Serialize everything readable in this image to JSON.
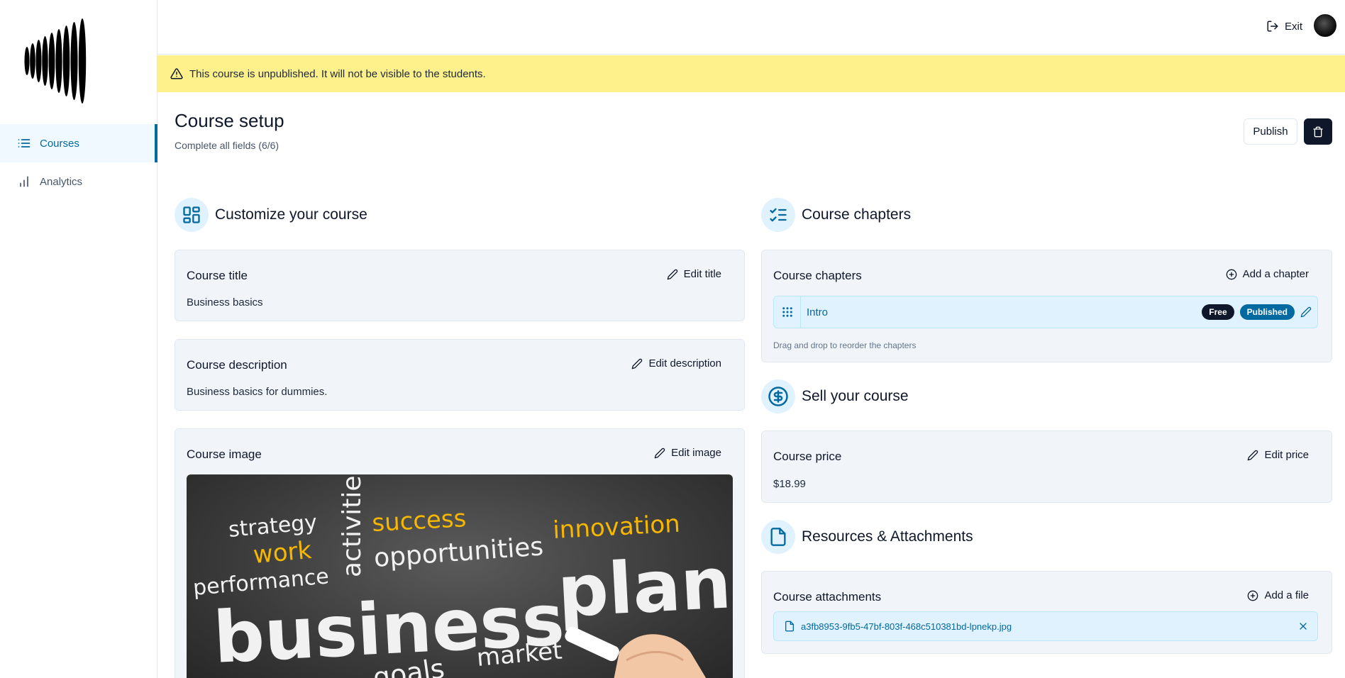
{
  "sidebar": {
    "items": [
      {
        "label": "Courses",
        "icon": "list-icon",
        "active": true
      },
      {
        "label": "Analytics",
        "icon": "bar-chart-icon",
        "active": false
      }
    ]
  },
  "topbar": {
    "exit_label": "Exit"
  },
  "banner": {
    "text": "This course is unpublished. It will not be visible to the students."
  },
  "header": {
    "title": "Course setup",
    "subtitle": "Complete all fields (6/6)",
    "publish_label": "Publish"
  },
  "customize": {
    "heading": "Customize your course",
    "title_card": {
      "label": "Course title",
      "action": "Edit title",
      "value": "Business basics"
    },
    "description_card": {
      "label": "Course description",
      "action": "Edit description",
      "value": "Business basics for dummies."
    },
    "image_card": {
      "label": "Course image",
      "action": "Edit image",
      "image_words": [
        "strategy",
        "work",
        "performance",
        "activities",
        "success",
        "opportunities",
        "innovation",
        "business",
        "plan",
        "goals",
        "market"
      ]
    }
  },
  "chapters": {
    "heading": "Course chapters",
    "card_label": "Course chapters",
    "add_label": "Add a chapter",
    "items": [
      {
        "title": "Intro",
        "badges": [
          "Free",
          "Published"
        ]
      }
    ],
    "hint": "Drag and drop to reorder the chapters"
  },
  "sell": {
    "heading": "Sell your course",
    "price_card": {
      "label": "Course price",
      "action": "Edit price",
      "value": "$18.99"
    }
  },
  "resources": {
    "heading": "Resources & Attachments",
    "card_label": "Course attachments",
    "add_label": "Add a file",
    "files": [
      "a3fb8953-9fb5-47bf-803f-468c510381bd-lpnekp.jpg"
    ]
  },
  "colors": {
    "accent": "#0369a1",
    "accent_light": "#e0f2fe",
    "banner": "#fef08a",
    "dark": "#0f172a",
    "card_bg": "#f1f5f9"
  }
}
